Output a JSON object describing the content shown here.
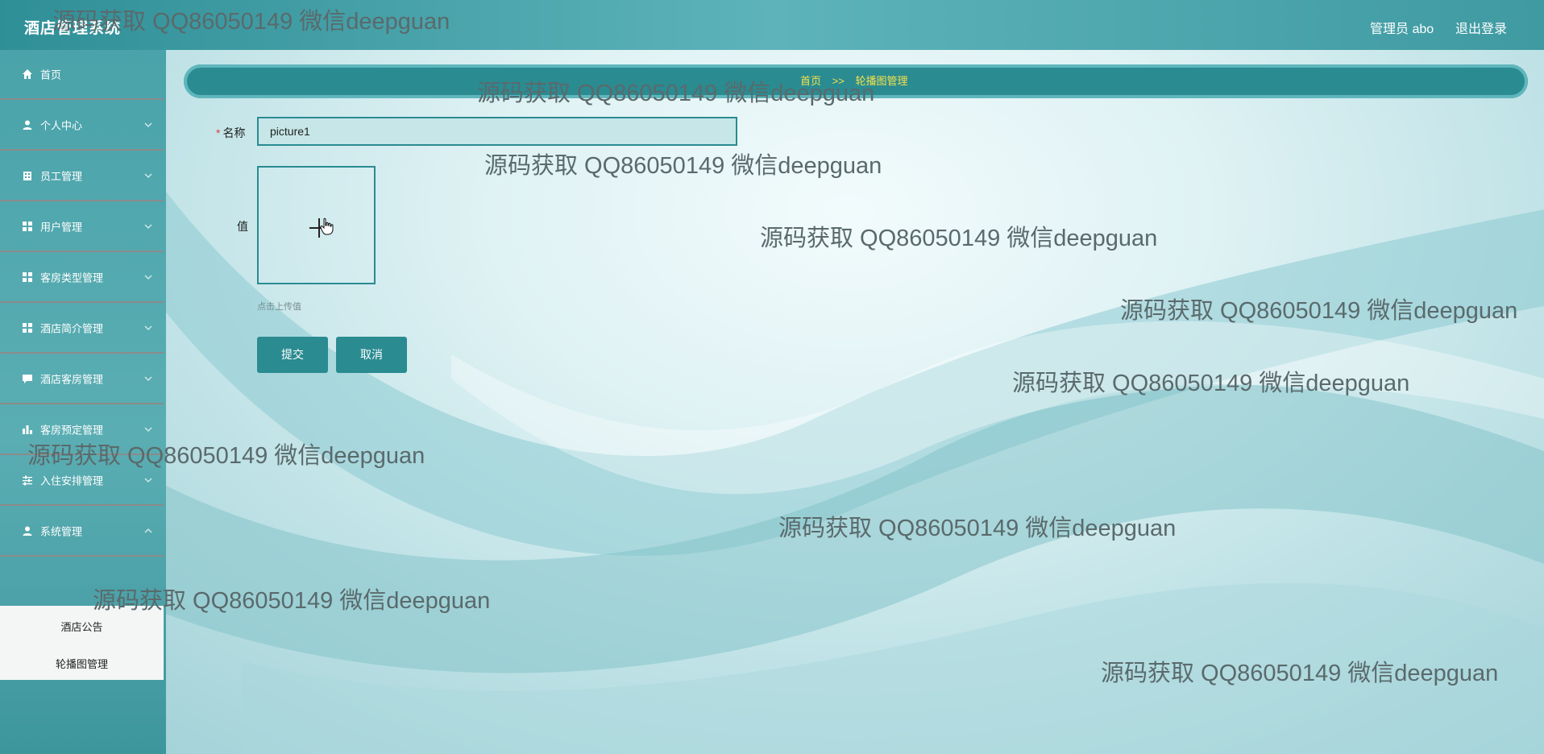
{
  "header": {
    "app_title": "酒店管理系统",
    "admin_label": "管理员 abo",
    "logout_label": "退出登录"
  },
  "sidebar": {
    "items": [
      {
        "label": "首页",
        "icon": "home-icon"
      },
      {
        "label": "个人中心",
        "icon": "user-icon"
      },
      {
        "label": "员工管理",
        "icon": "building-icon"
      },
      {
        "label": "用户管理",
        "icon": "grid-icon"
      },
      {
        "label": "客房类型管理",
        "icon": "grid-icon"
      },
      {
        "label": "酒店简介管理",
        "icon": "grid-icon"
      },
      {
        "label": "酒店客房管理",
        "icon": "chat-icon"
      },
      {
        "label": "客房预定管理",
        "icon": "bar-chart-icon"
      },
      {
        "label": "入住安排管理",
        "icon": "sliders-icon"
      },
      {
        "label": "系统管理",
        "icon": "user-icon"
      }
    ],
    "submenu": [
      "酒店公告",
      "轮播图管理"
    ]
  },
  "breadcrumb": {
    "home": "首页",
    "separator": ">>",
    "current": "轮播图管理"
  },
  "form": {
    "name_label": "名称",
    "name_value": "picture1",
    "value_label": "值",
    "upload_hint": "点击上传值",
    "submit_label": "提交",
    "cancel_label": "取消"
  },
  "watermark_text": "源码获取 QQ86050149 微信deepguan",
  "colors": {
    "accent": "#2a8b91",
    "breadcrumb_text": "#f5e24b",
    "topbar": "#3f9aa2"
  }
}
